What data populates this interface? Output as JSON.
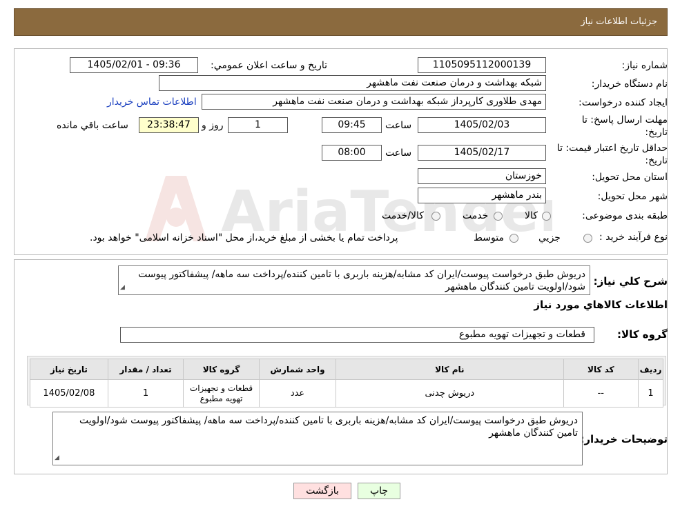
{
  "header": {
    "title": "جزئیات اطلاعات نیاز"
  },
  "fields": {
    "need_number_label": "شماره نیاز:",
    "need_number": "1105095112000139",
    "announce_label": "تاریخ و ساعت اعلان عمومي:",
    "announce_value": "1405/02/01 - 09:36",
    "buyer_org_label": "نام دستگاه خریدار:",
    "buyer_org": "شبکه بهداشت و درمان صنعت نفت ماهشهر",
    "creator_label": "ایجاد کننده درخواست:",
    "creator": "مهدی طلاوری کارپرداز شبکه بهداشت و درمان صنعت نفت ماهشهر",
    "contact_link": "اطلاعات تماس خریدار",
    "deadline_label_1": "مهلت ارسال پاسخ: تا",
    "deadline_label_2": "تاریخ:",
    "deadline_date": "1405/02/03",
    "time_label": "ساعت",
    "deadline_time": "09:45",
    "days_value": "1",
    "days_label": "روز و",
    "remaining_time": "23:38:47",
    "remaining_label": "ساعت باقي مانده",
    "validity_label_1": "حداقل تاریخ اعتبار قیمت: تا",
    "validity_label_2": "تاریخ:",
    "validity_date": "1405/02/17",
    "validity_time": "08:00",
    "province_label": "استان محل تحویل:",
    "province": "خوزستان",
    "city_label": "شهر محل تحویل:",
    "city": "بندر ماهشهر",
    "category_label": "طبقه بندی موضوعی:",
    "category_options": [
      "کالا",
      "خدمت",
      "کالا/خدمت"
    ],
    "process_label": "نوع فرآیند خرید :",
    "process_options": [
      "جزیي",
      "متوسط"
    ],
    "process_note": "پرداخت تمام یا بخشی از مبلغ خرید،از محل \"اسناد خزانه اسلامی\" خواهد بود."
  },
  "summary": {
    "label": "شرح کلي نیاز:",
    "text": "دریوش طبق درخواست پیوست/ایران کد مشابه/هزینه باربری با تامین کننده/پرداخت سه ماهه/ پیشفاکتور پیوست شود/اولویت تامین کنندگان ماهشهر"
  },
  "goods_section": {
    "title": "اطلاعات کالاهاي مورد نیاز",
    "group_label": "گروه کالا:",
    "group_value": "قطعات و تجهیزات تهویه مطبوع"
  },
  "table": {
    "headers": [
      "ردیف",
      "کد کالا",
      "نام کالا",
      "واحد شمارش",
      "گروه کالا",
      "تعداد / مقدار",
      "تاریخ نیاز"
    ],
    "rows": [
      [
        "1",
        "--",
        "دریوش چدنی",
        "عدد",
        "قطعات و تجهیزات تهویه مطبوع",
        "1",
        "1405/02/08"
      ]
    ]
  },
  "buyer_notes": {
    "label": "توضیحات خریدار:",
    "text": "دریوش طبق درخواست پیوست/ایران کد مشابه/هزینه باربری با تامین کننده/پرداخت سه ماهه/ پیشفاکتور پیوست شود/اولویت تامین کنندگان ماهشهر"
  },
  "buttons": {
    "print": "چاپ",
    "back": "بازگشت"
  },
  "watermark": {
    "text": "AriaTender.neT"
  },
  "colors": {
    "header_bg": "#8b6a3e",
    "link": "#1a3fbf",
    "back_button_bg": "#ffe0e0",
    "print_button_bg": "#e8ffe0"
  }
}
